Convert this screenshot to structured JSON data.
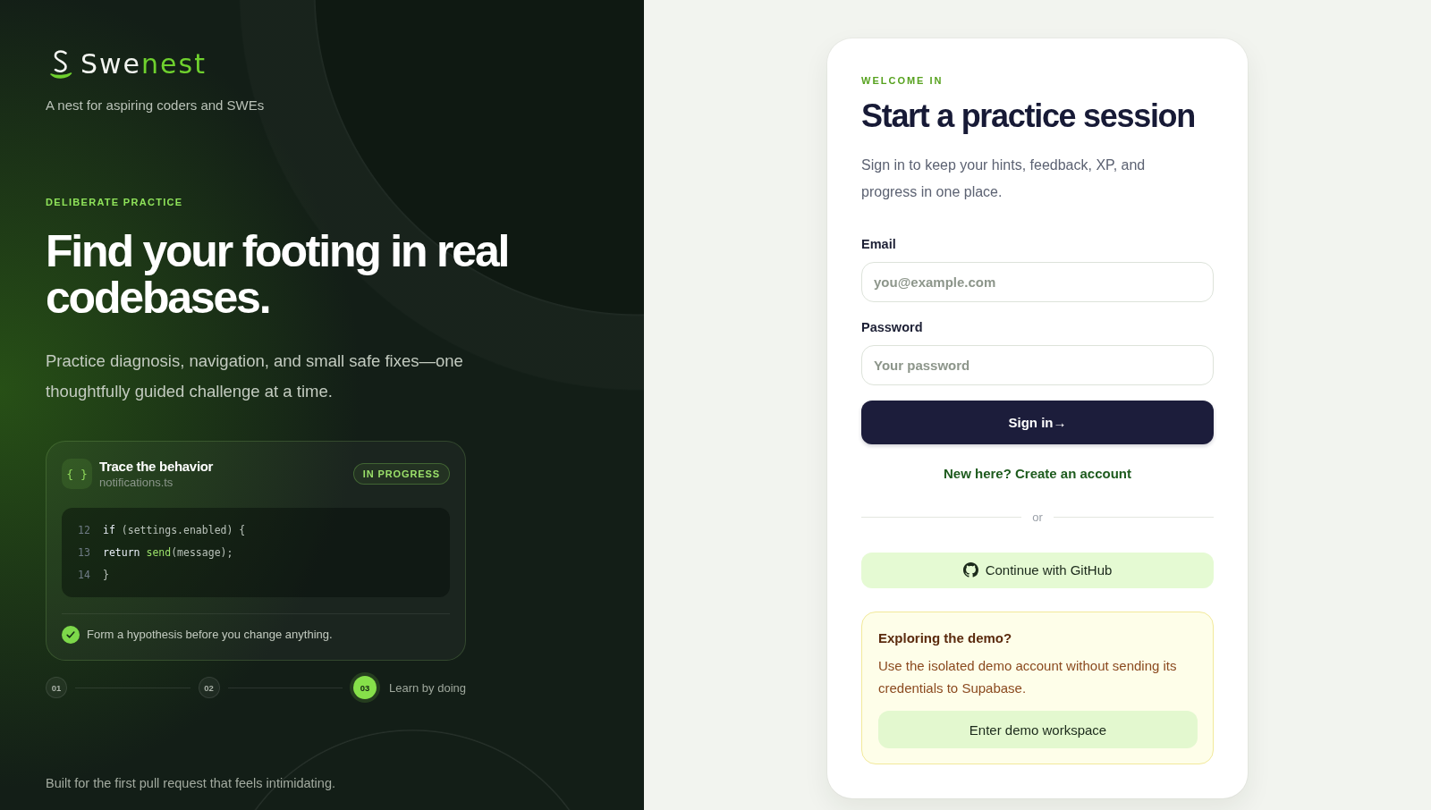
{
  "brand": {
    "name": "Swe",
    "name_accent": "nest",
    "tagline": "A nest for aspiring coders and SWEs"
  },
  "hero": {
    "eyebrow": "DELIBERATE PRACTICE",
    "title": "Find your footing in real codebases.",
    "description": "Practice diagnosis, navigation, and small safe fixes—one thoughtfully guided challenge at a time."
  },
  "challenge_card": {
    "icon_text": "{ }",
    "title": "Trace the behavior",
    "file": "notifications.ts",
    "status": "IN PROGRESS",
    "code_lines": [
      {
        "number": "12",
        "tokens": [
          {
            "kind": "keyword",
            "text": "if"
          },
          {
            "kind": "plain",
            "text": " (settings.enabled) {"
          }
        ]
      },
      {
        "number": "13",
        "tokens": [
          {
            "kind": "keyword",
            "text": "return"
          },
          {
            "kind": "function",
            "text": " send"
          },
          {
            "kind": "plain",
            "text": "(message);"
          }
        ]
      },
      {
        "number": "14",
        "tokens": [
          {
            "kind": "plain",
            "text": "}"
          }
        ]
      }
    ],
    "hint": {
      "checked": true,
      "text": "Form a hypothesis before you change anything."
    }
  },
  "steps": [
    {
      "label": "01",
      "selected": false
    },
    {
      "label": "02",
      "selected": false
    },
    {
      "label": "03",
      "selected": true,
      "caption": "Learn by doing"
    }
  ],
  "footer": "Built for the first pull request that feels intimidating.",
  "login": {
    "eyebrow": "WELCOME IN",
    "title": "Start a practice session",
    "subtitle": "Sign in to keep your hints, feedback, XP, and progress in one place.",
    "fields": [
      {
        "label": "Email",
        "placeholder": "you@example.com"
      },
      {
        "label": "Password",
        "placeholder": "Your password"
      }
    ],
    "submit": "Sign in→",
    "signup_link": "New here? Create an account",
    "divider": "or",
    "github_button": "Continue with GitHub",
    "demo": {
      "title": "Exploring the demo?",
      "text": "Use the isolated demo account without sending its credentials to Supabase.",
      "button": "Enter demo workspace"
    }
  }
}
